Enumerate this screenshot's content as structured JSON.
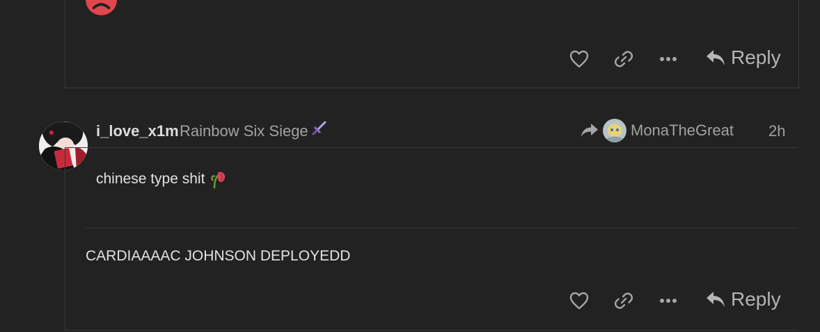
{
  "colors": {
    "background": "#222222",
    "border": "#3a3a3a",
    "muted": "#a2a2a2",
    "sad_reaction": "#e0474c"
  },
  "previous_post": {
    "reaction_icon": "sad-face-icon",
    "actions": {
      "like_icon": "heart-icon",
      "link_icon": "link-icon",
      "more_icon": "ellipsis-icon",
      "reply_label": "Reply"
    }
  },
  "post": {
    "username": "i_love_x1m",
    "flair": "Rainbow Six Siege",
    "flair_icon": "sword-icon",
    "reply_to_icon": "share-arrow-icon",
    "reply_to_user": "MonaTheGreat",
    "timestamp": "2h",
    "quote_text": "chinese type shit",
    "quote_emoji_icon": "wilted-flower-icon",
    "body": "CARDIAAAAC JOHNSON DEPLOYEDD",
    "actions": {
      "like_icon": "heart-icon",
      "link_icon": "link-icon",
      "more_icon": "ellipsis-icon",
      "reply_label": "Reply"
    }
  }
}
